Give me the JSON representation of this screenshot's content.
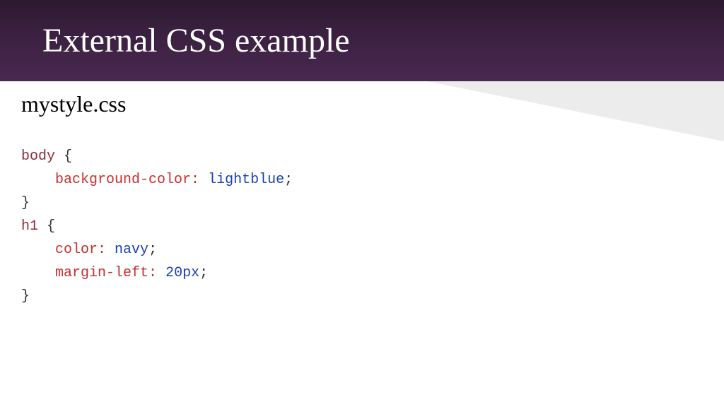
{
  "header": {
    "title": "External CSS example"
  },
  "content": {
    "filename": "mystyle.css",
    "code_lines": [
      {
        "sel": "body",
        "sp0": " ",
        "open": "{"
      },
      {
        "indent": "    ",
        "prop": "background-color:",
        "sp1": " ",
        "val": "lightblue",
        "semi": ";"
      },
      {
        "close": "}"
      },
      {
        "sel": "h1",
        "sp0": " ",
        "open": "{"
      },
      {
        "indent": "    ",
        "prop": "color:",
        "sp1": " ",
        "val": "navy",
        "semi": ";"
      },
      {
        "indent": "    ",
        "prop": "margin-left:",
        "sp1": " ",
        "val": "20px",
        "semi": ";"
      },
      {
        "close": "}"
      }
    ]
  },
  "colors": {
    "header_bg_start": "#2a1a2e",
    "header_bg_end": "#4a2850",
    "selector": "#8b2b3a",
    "property": "#c72e2e",
    "value": "#1a3fb0",
    "punct": "#333333",
    "diagonal": "#ececec"
  }
}
